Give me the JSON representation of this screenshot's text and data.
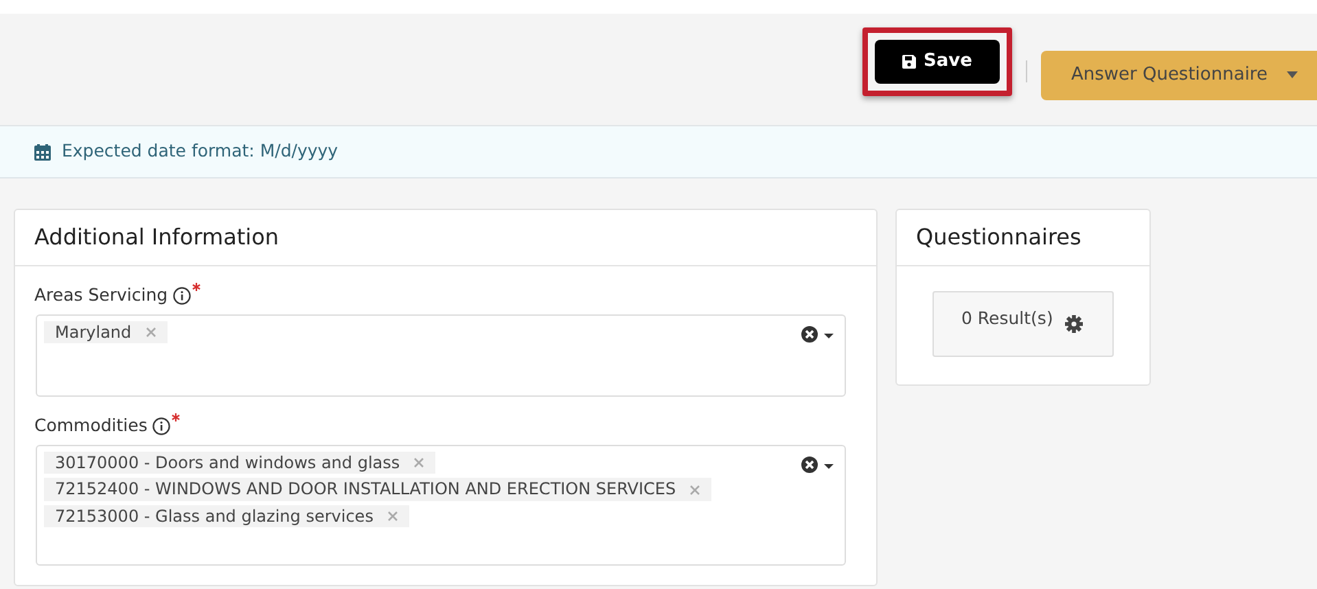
{
  "toolbar": {
    "buttons": [
      {
        "kind": "save",
        "label": "Save",
        "highlighted": true
      },
      {
        "kind": "dropdown",
        "label": "Answer Questionnaire",
        "highlighted": false
      }
    ]
  },
  "info_bar": {
    "text": "Expected date format: M/d/yyyy"
  },
  "additional_information": {
    "title": "Additional Information",
    "fields": [
      {
        "label": "Areas Servicing",
        "required": true,
        "tags": [
          "Maryland"
        ]
      },
      {
        "label": "Commodities",
        "required": true,
        "tags": [
          "30170000 - Doors and windows and glass",
          "72152400 - WINDOWS AND DOOR INSTALLATION AND ERECTION SERVICES",
          "72153000 - Glass and glazing services"
        ]
      }
    ]
  },
  "questionnaires": {
    "title": "Questionnaires",
    "results": "0 Result(s)"
  }
}
